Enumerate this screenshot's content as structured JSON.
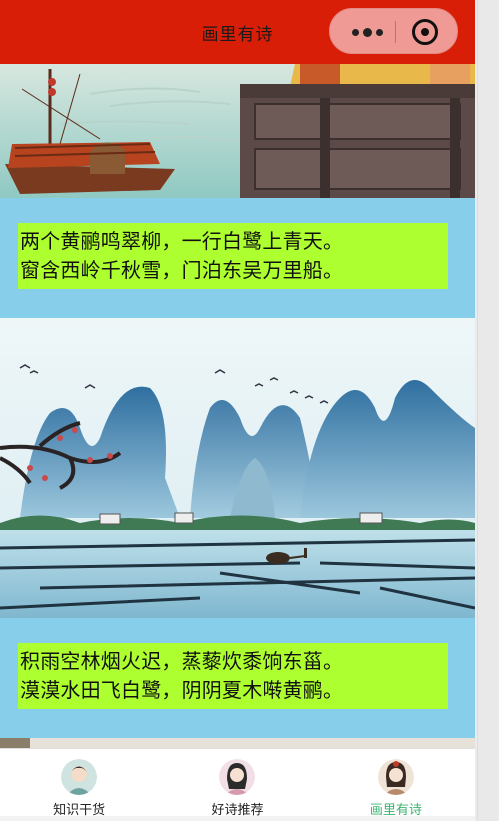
{
  "header": {
    "title": "画里有诗"
  },
  "capsule": {
    "menu_icon": "more-dots-icon",
    "close_icon": "target-circle-icon"
  },
  "poems": [
    {
      "lines": [
        "两个黄鹂鸣翠柳，一行白鹭上青天。",
        "窗含西岭千秋雪，门泊东吴万里船。"
      ]
    },
    {
      "lines": [
        "积雨空林烟火迟，蒸藜炊黍饷东菑。",
        "漠漠水田飞白鹭，阴阴夏木啭黄鹂。"
      ]
    }
  ],
  "tabs": [
    {
      "label": "知识干货",
      "icon": "avatar-boy-icon",
      "active": false
    },
    {
      "label": "好诗推荐",
      "icon": "avatar-girl-icon",
      "active": false
    },
    {
      "label": "画里有诗",
      "icon": "avatar-lady-icon",
      "active": true
    }
  ],
  "colors": {
    "header": "#d81e06",
    "poem_bg": "#87ceeb",
    "highlight": "#adff2f",
    "active_tab": "#3cb371"
  }
}
